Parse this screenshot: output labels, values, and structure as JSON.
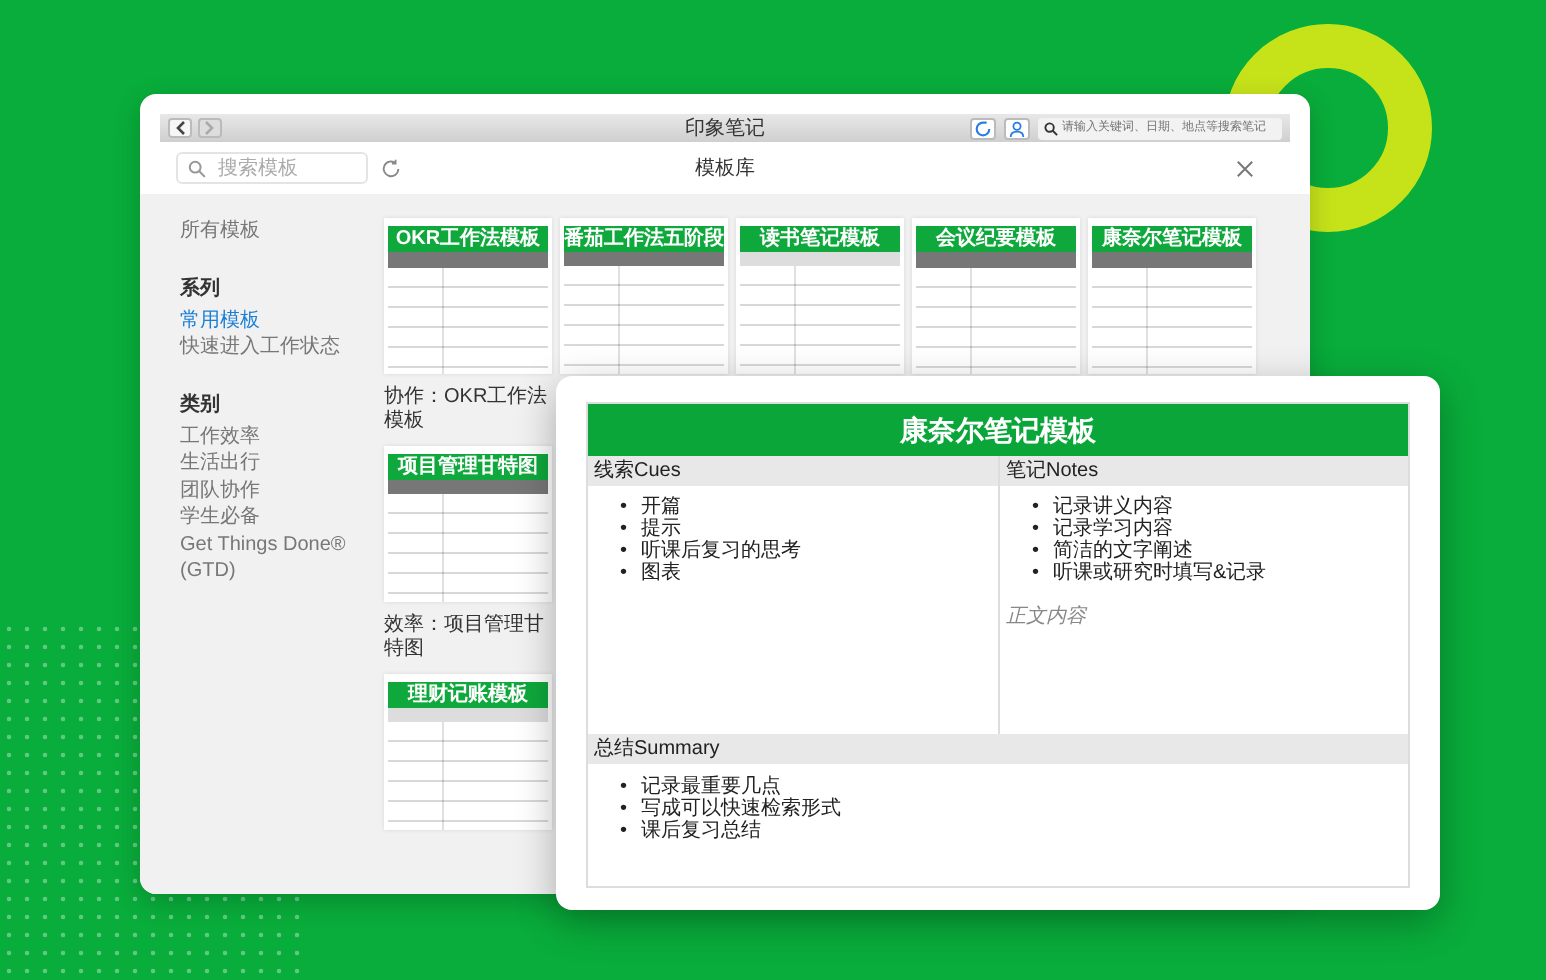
{
  "window": {
    "title": "印象笔记",
    "search_placeholder": "请输入关键词、日期、地点等搜索笔记"
  },
  "library": {
    "title": "模板库",
    "search": {
      "placeholder": "搜索模板"
    }
  },
  "sidebar": {
    "all": "所有模板",
    "sections": [
      {
        "heading": "系列",
        "items": [
          {
            "label": "常用模板",
            "selected": true
          },
          {
            "label": "快速进入工作状态",
            "selected": false
          }
        ]
      },
      {
        "heading": "类别",
        "items": [
          {
            "label": "工作效率",
            "selected": false
          },
          {
            "label": "生活出行",
            "selected": false
          },
          {
            "label": "团队协作",
            "selected": false
          },
          {
            "label": "学生必备",
            "selected": false
          },
          {
            "label": "Get Things Done® (GTD)",
            "selected": false
          }
        ]
      }
    ]
  },
  "templates": [
    {
      "title": "OKR工作法模板",
      "caption": "协作：OKR工作法模板"
    },
    {
      "title": "番茄工作法五阶段"
    },
    {
      "title": "读书笔记模板"
    },
    {
      "title": "会议纪要模板"
    },
    {
      "title": "康奈尔笔记模板"
    },
    {
      "title": "项目管理甘特图",
      "caption": "效率：项目管理甘特图"
    },
    {
      "title": "理财记账模板"
    }
  ],
  "preview": {
    "title": "康奈尔笔记模板",
    "bullet": "•",
    "columns": [
      {
        "heading": "线索Cues",
        "items": [
          "开篇",
          "提示",
          "听课后复习的思考",
          "图表"
        ]
      },
      {
        "heading": "笔记Notes",
        "items": [
          "记录讲义内容",
          "记录学习内容",
          "简洁的文字阐述",
          "听课或研究时填写&记录"
        ],
        "note": "正文内容"
      }
    ],
    "summary": {
      "heading": "总结Summary",
      "items": [
        "记录最重要几点",
        "写成可以快速检索形式",
        "课后复习总结"
      ]
    }
  }
}
